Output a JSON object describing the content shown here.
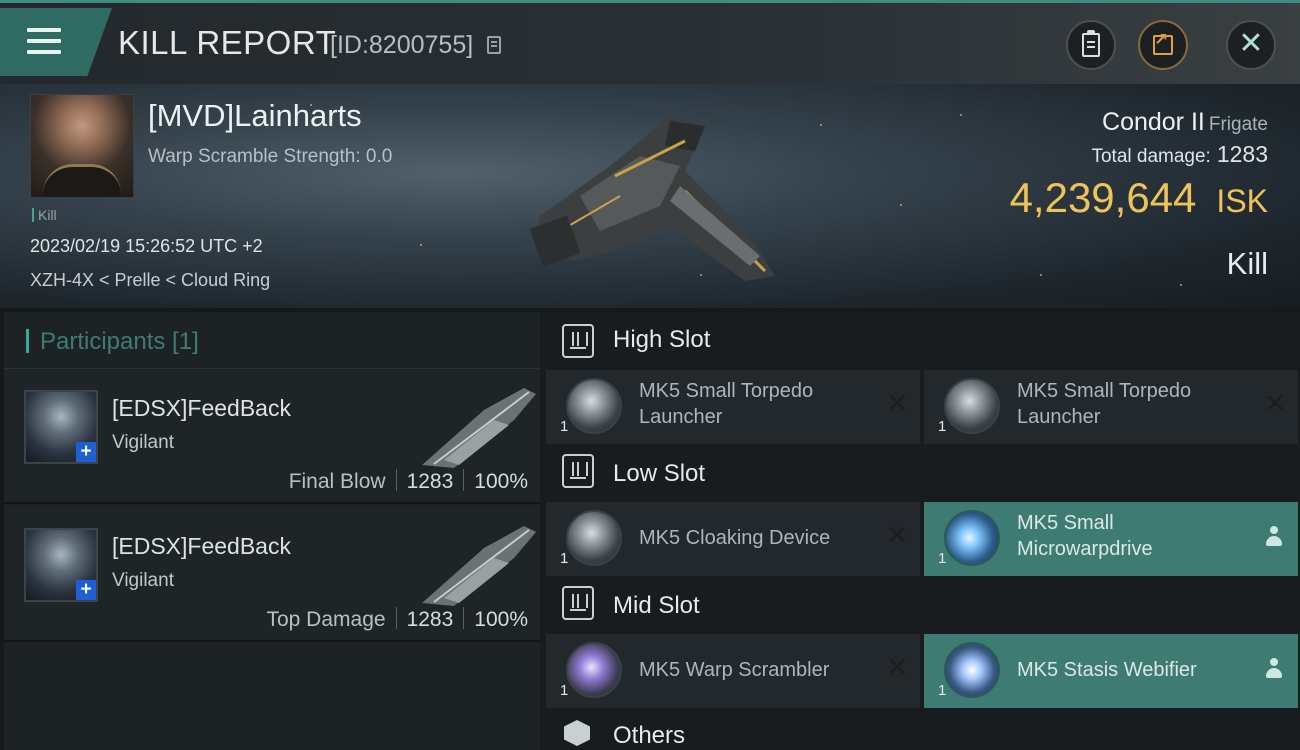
{
  "header": {
    "title": "KILL REPORT",
    "report_id": "[ID:8200755]",
    "menu_icon": "hamburger-menu-icon",
    "actions": [
      "clipboard-icon",
      "share-icon",
      "close-icon"
    ]
  },
  "victim": {
    "pilot_name": "[MVD]Lainharts",
    "warp_scramble": "Warp Scramble Strength: 0.0",
    "kill_tag": "Kill",
    "timestamp": "2023/02/19 15:26:52 UTC +2",
    "location": "XZH-4X < Prelle < Cloud Ring",
    "ship_name": "Condor II",
    "ship_class": "Frigate",
    "total_damage_label": "Total damage:",
    "total_damage": "1283",
    "isk_value": "4,239,644",
    "isk_unit": "ISK",
    "result": "Kill"
  },
  "participants": {
    "header": "Participants [1]",
    "rows": [
      {
        "name": "[EDSX]FeedBack",
        "ship": "Vigilant",
        "role": "Final Blow",
        "damage": "1283",
        "percent": "100%"
      },
      {
        "name": "[EDSX]FeedBack",
        "ship": "Vigilant",
        "role": "Top Damage",
        "damage": "1283",
        "percent": "100%"
      }
    ]
  },
  "fittings": {
    "high_slot": {
      "title": "High Slot",
      "modules": [
        {
          "name": "MK5 Small Torpedo Launcher",
          "qty": "1",
          "status": "destroyed"
        },
        {
          "name": "MK5 Small Torpedo Launcher",
          "qty": "1",
          "status": "destroyed"
        }
      ]
    },
    "low_slot": {
      "title": "Low Slot",
      "modules": [
        {
          "name": "MK5 Cloaking Device",
          "qty": "1",
          "status": "destroyed"
        },
        {
          "name": "MK5 Small Microwarpdrive",
          "qty": "1",
          "status": "dropped"
        }
      ]
    },
    "mid_slot": {
      "title": "Mid Slot",
      "modules": [
        {
          "name": "MK5 Warp Scrambler",
          "qty": "1",
          "status": "destroyed"
        },
        {
          "name": "MK5 Stasis Webifier",
          "qty": "1",
          "status": "dropped"
        }
      ]
    },
    "others": {
      "title": "Others"
    }
  },
  "colors": {
    "accent": "#3f8c80",
    "isk_gold": "#f0c35a",
    "dropped_bg": "#3e7b72"
  }
}
